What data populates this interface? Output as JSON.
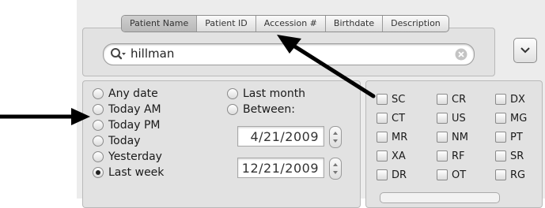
{
  "tabs": [
    {
      "label": "Patient Name",
      "active": true
    },
    {
      "label": "Patient ID",
      "active": false
    },
    {
      "label": "Accession #",
      "active": false
    },
    {
      "label": "Birthdate",
      "active": false
    },
    {
      "label": "Description",
      "active": false
    }
  ],
  "search": {
    "value": "hillman",
    "icon": "search-icon",
    "clear_icon": "clear-icon"
  },
  "menu_button": {
    "icon": "chevron-down-icon"
  },
  "date_options_left": [
    {
      "label": "Any date",
      "checked": false
    },
    {
      "label": "Today AM",
      "checked": false
    },
    {
      "label": "Today PM",
      "checked": false
    },
    {
      "label": "Today",
      "checked": false
    },
    {
      "label": "Yesterday",
      "checked": false
    },
    {
      "label": "Last week",
      "checked": true
    }
  ],
  "date_options_right": [
    {
      "label": "Last month",
      "checked": false
    },
    {
      "label": "Between:",
      "checked": false
    }
  ],
  "date_from": "4/21/2009",
  "date_to": "12/21/2009",
  "modalities": [
    [
      "SC",
      "CR",
      "DX"
    ],
    [
      "CT",
      "US",
      "MG"
    ],
    [
      "MR",
      "NM",
      "PT"
    ],
    [
      "XA",
      "RF",
      "SR"
    ],
    [
      "DR",
      "OT",
      "RG"
    ]
  ]
}
